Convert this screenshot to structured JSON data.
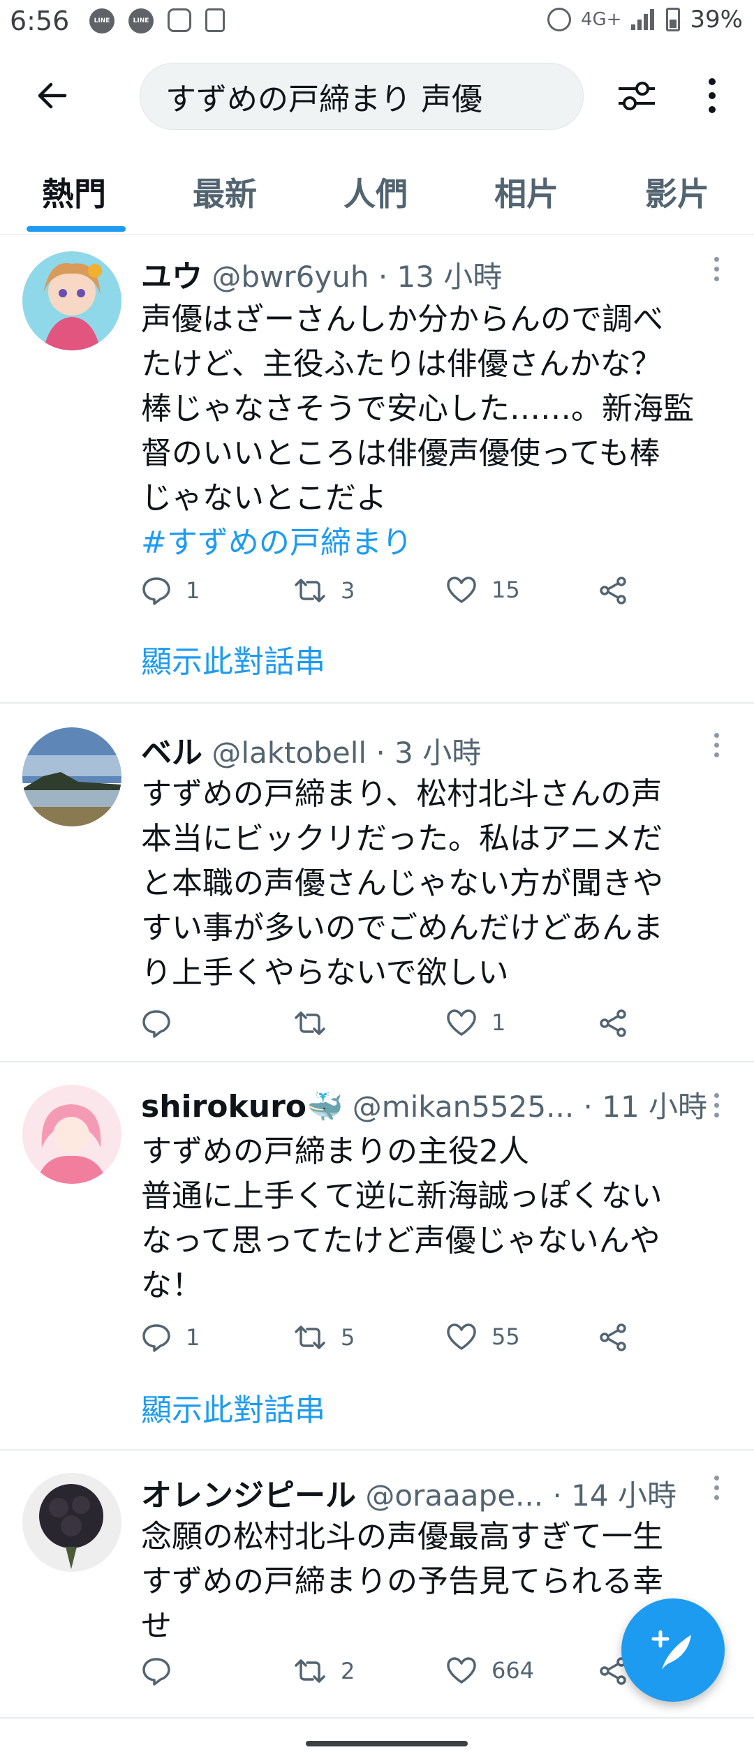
{
  "status_bar": {
    "time": "6:56",
    "apps": [
      "LINE",
      "LINE"
    ],
    "network": "4G+",
    "battery": "39%"
  },
  "search": {
    "query": "すずめの戸締まり 声優"
  },
  "tabs": [
    {
      "label": "熱門",
      "active": true
    },
    {
      "label": "最新",
      "active": false
    },
    {
      "label": "人們",
      "active": false
    },
    {
      "label": "相片",
      "active": false
    },
    {
      "label": "影片",
      "active": false
    }
  ],
  "colors": {
    "accent": "#1d9bf0",
    "text": "#0f1419",
    "muted": "#536471"
  },
  "tweets": [
    {
      "name": "ユウ",
      "handle": "@bwr6yuh",
      "time": "· 13 小時",
      "text": "声優はざーさんしか分からんので調べ\nたけど、主役ふたりは俳優さんかな？\n棒じゃなさそうで安心した……。新海監\n督のいいところは俳優声優使っても棒\nじゃないとこだよ",
      "hashtag": "#すずめの戸締まり",
      "replies": "1",
      "retweets": "3",
      "likes": "15",
      "thread_link": "顯示此對話串"
    },
    {
      "name": "ベル",
      "handle": "@laktobell",
      "time": "· 3 小時",
      "text": "すずめの戸締まり、松村北斗さんの声\n本当にビックリだった。私はアニメだ\nと本職の声優さんじゃない方が聞きや\nすい事が多いのでごめんだけどあんま\nり上手くやらないで欲しい",
      "replies": "",
      "retweets": "",
      "likes": "1"
    },
    {
      "name": "shirokuro",
      "name_emoji": "🐳",
      "handle": "@mikan5525...",
      "time": "· 11 小時",
      "text": "すずめの戸締まりの主役2人\n普通に上手くて逆に新海誠っぽくない\nなって思ってたけど声優じゃないんや\nな！",
      "replies": "1",
      "retweets": "5",
      "likes": "55",
      "thread_link": "顯示此對話串"
    },
    {
      "name": "オレンジピール",
      "handle": "@oraaape...",
      "time": "· 14 小時",
      "text": "念願の松村北斗の声優最高すぎて一生\nすずめの戸締まりの予告見てられる幸\nせ",
      "replies": "",
      "retweets": "2",
      "likes": "664"
    }
  ]
}
